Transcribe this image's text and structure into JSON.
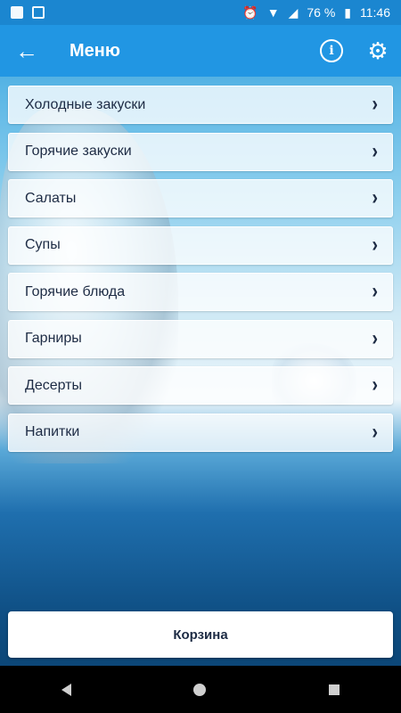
{
  "status_bar": {
    "battery": "76 %",
    "time": "11:46",
    "icons": [
      "outlook-icon",
      "image-icon",
      "alarm-icon",
      "wifi-icon",
      "signal-icon",
      "battery-icon"
    ]
  },
  "app_bar": {
    "title": "Меню",
    "back_icon": "arrow-left-icon",
    "info_icon": "info-icon",
    "settings_icon": "gear-icon"
  },
  "menu": {
    "items": [
      {
        "label": "Холодные закуски"
      },
      {
        "label": "Горячие закуски"
      },
      {
        "label": "Салаты"
      },
      {
        "label": "Супы"
      },
      {
        "label": "Горячие блюда"
      },
      {
        "label": "Гарниры"
      },
      {
        "label": "Десерты"
      },
      {
        "label": "Напитки"
      }
    ]
  },
  "cart_button": {
    "label": "Корзина"
  },
  "colors": {
    "app_bar": "#2196e3",
    "status_bar": "#1b86d0",
    "text": "#1d2b44"
  }
}
